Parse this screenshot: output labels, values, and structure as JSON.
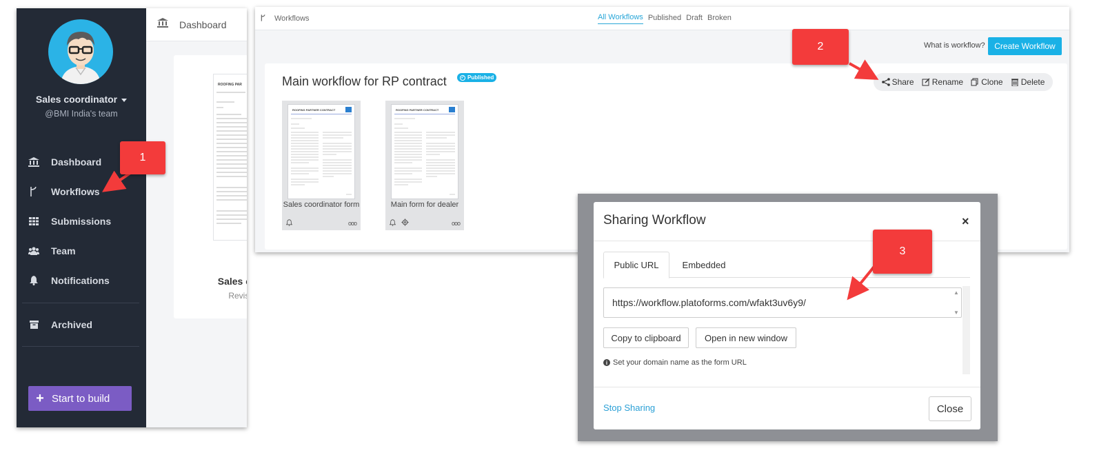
{
  "left_app": {
    "user": {
      "name": "Sales coordinator",
      "team": "@BMI India's team"
    },
    "nav": [
      {
        "label": "Dashboard",
        "icon": "bank-icon"
      },
      {
        "label": "Workflows",
        "icon": "workflow-icon"
      },
      {
        "label": "Submissions",
        "icon": "grid-icon"
      },
      {
        "label": "Team",
        "icon": "team-icon"
      },
      {
        "label": "Notifications",
        "icon": "bell-icon"
      },
      {
        "label": "Archived",
        "icon": "archive-icon"
      }
    ],
    "start_build_label": "Start to build",
    "topbar_title": "Dashboard",
    "card": {
      "doc_heading": "ROOFING PAR",
      "title": "Sales c",
      "subtitle": "Revisi"
    },
    "colors": {
      "sidebar": "#232a36",
      "accent": "#7b5cc4",
      "avatar_bg": "#2bb3e6"
    }
  },
  "workflows_window": {
    "breadcrumb": "Workflows",
    "filter_tabs": [
      "All Workflows",
      "Published",
      "Draft",
      "Broken"
    ],
    "active_filter": "All Workflows",
    "help_link": "What is workflow?",
    "create_button": "Create Workflow",
    "workflow": {
      "title": "Main workflow for RP contract",
      "badge": "Published",
      "actions": [
        "Share",
        "Rename",
        "Clone",
        "Delete"
      ],
      "forms": [
        {
          "label": "Sales coordinator form",
          "doc_heading": "ROOFING PARTNER CONTRACT"
        },
        {
          "label": "Main form for dealer",
          "doc_heading": "ROOFING PARTNER CONTRACT"
        }
      ]
    },
    "colors": {
      "accent": "#1ab1e6"
    }
  },
  "sharing_modal": {
    "title": "Sharing Workflow",
    "close_x": "×",
    "tabs": [
      "Public URL",
      "Embedded"
    ],
    "active_tab": "Public URL",
    "url": "https://workflow.platoforms.com/wfakt3uv6y9/",
    "copy_button": "Copy to clipboard",
    "open_button": "Open in new window",
    "hint": "Set your domain name as the form URL",
    "stop_sharing": "Stop Sharing",
    "close_button": "Close"
  },
  "callouts": [
    "1",
    "2",
    "3"
  ],
  "callout_color": "#f33b3b"
}
